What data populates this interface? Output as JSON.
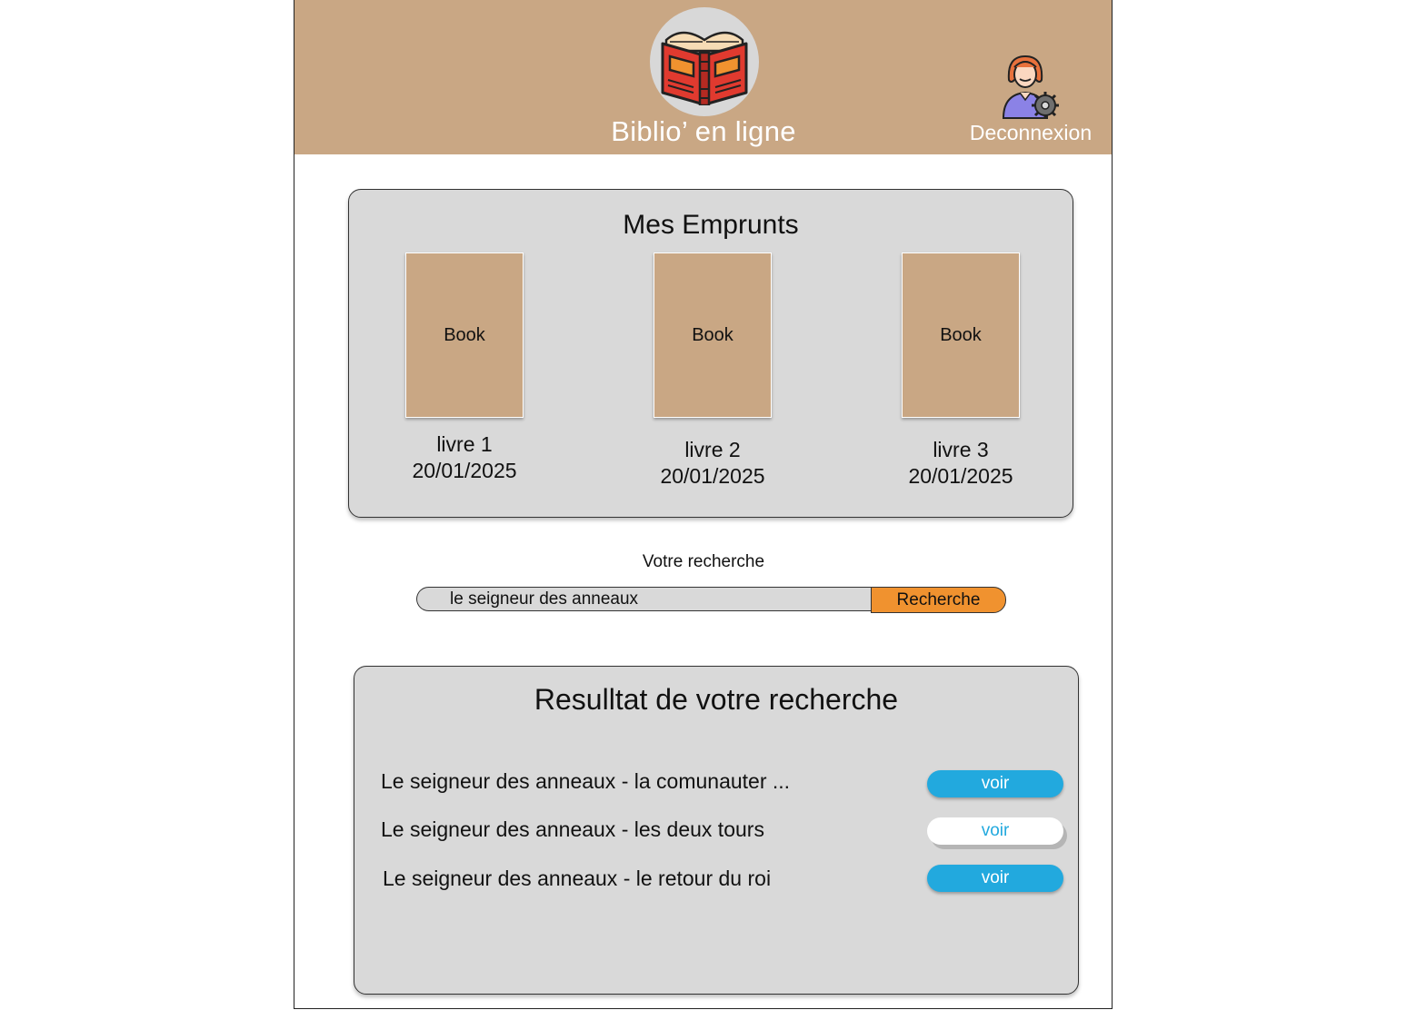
{
  "header": {
    "app_title": "Biblio’ en ligne",
    "logout_label": "Deconnexion",
    "logo_icon": "open-book-icon",
    "user_icon": "user-settings-icon",
    "background_color": "#c9a784"
  },
  "loans": {
    "title": "Mes Emprunts",
    "items": [
      {
        "cover_label": "Book",
        "name": "livre 1",
        "date": "20/01/2025"
      },
      {
        "cover_label": "Book",
        "name": "livre 2",
        "date": "20/01/2025"
      },
      {
        "cover_label": "Book",
        "name": "livre 3",
        "date": "20/01/2025"
      }
    ]
  },
  "search": {
    "label": "Votre recherche",
    "value": "le seigneur des anneaux",
    "button_label": "Recherche",
    "button_color": "#f0922f"
  },
  "results": {
    "title": "Resulltat de votre recherche",
    "items": [
      {
        "title": "Le seigneur des anneaux - la comunauter ...",
        "button_label": "voir"
      },
      {
        "title": "Le seigneur des anneaux - les deux tours",
        "button_label": "voir"
      },
      {
        "title": "Le seigneur des anneaux - le retour du roi",
        "button_label": "voir"
      }
    ],
    "button_color": "#22a9de"
  }
}
